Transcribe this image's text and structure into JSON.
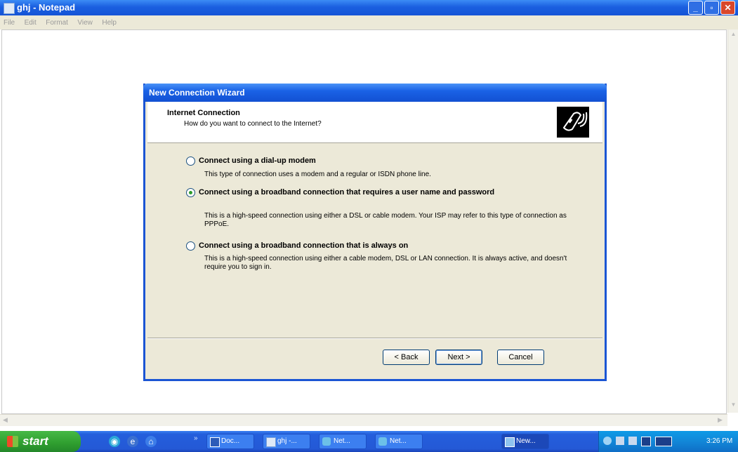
{
  "notepad": {
    "title": "ghj - Notepad",
    "menu": [
      "File",
      "Edit",
      "Format",
      "View",
      "Help"
    ],
    "controls": {
      "minimize": "_",
      "maximize": "▫",
      "close": "✕"
    }
  },
  "wizard": {
    "title": "New Connection Wizard",
    "header_title": "Internet Connection",
    "header_subtitle": "How do you want to connect to the Internet?",
    "options": [
      {
        "label": "Connect using a dial-up modem",
        "description": "This type of connection uses a modem and a regular or ISDN phone line.",
        "selected": false
      },
      {
        "label": "Connect using a broadband connection that requires a user name and password",
        "description": "This is a high-speed connection using either a DSL or cable modem. Your ISP may refer to this type of connection as PPPoE.",
        "selected": true
      },
      {
        "label": "Connect using a broadband connection that is always on",
        "description": "This is a high-speed connection using either a cable modem, DSL or LAN connection. It is always active, and doesn't require you to sign in.",
        "selected": false
      }
    ],
    "buttons": {
      "back": "< Back",
      "next": "Next >",
      "cancel": "Cancel"
    }
  },
  "taskbar": {
    "start_label": "start",
    "tasks": [
      {
        "label": "Doc...",
        "icon": "word-doc-icon"
      },
      {
        "label": "ghj -...",
        "icon": "notepad-icon"
      },
      {
        "label": "Net...",
        "icon": "network-icon"
      },
      {
        "label": "Net...",
        "icon": "network-icon"
      },
      {
        "label": "New...",
        "icon": "wizard-icon"
      }
    ],
    "clock": "3:26 PM"
  }
}
